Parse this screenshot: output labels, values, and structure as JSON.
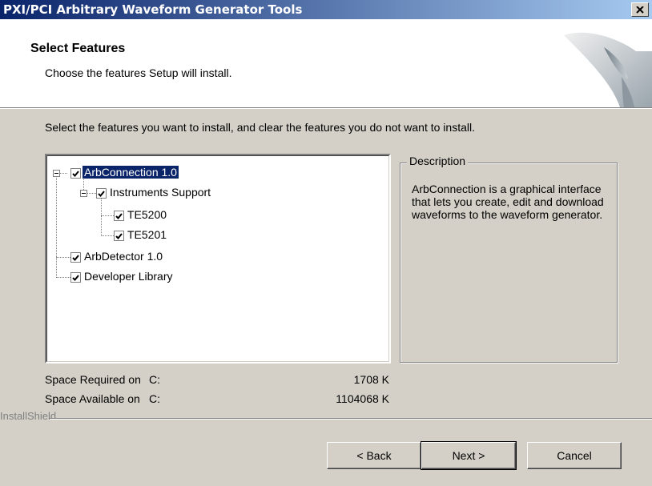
{
  "window": {
    "title": "PXI/PCI Arbitrary Waveform Generator Tools"
  },
  "header": {
    "title": "Select Features",
    "subtitle": "Choose the features Setup will install."
  },
  "instruction": "Select the features you want to install, and clear the features you do not want to install.",
  "tree": {
    "items": [
      {
        "label": "ArbConnection 1.0",
        "checked": true
      },
      {
        "label": "Instruments Support",
        "checked": true
      },
      {
        "label": "TE5200",
        "checked": true
      },
      {
        "label": "TE5201",
        "checked": true
      },
      {
        "label": "ArbDetector 1.0",
        "checked": true
      },
      {
        "label": "Developer Library",
        "checked": true
      }
    ]
  },
  "description": {
    "legend": "Description",
    "text": "ArbConnection is a graphical interface that lets you create, edit and download waveforms to the waveform generator."
  },
  "space": {
    "required": {
      "label": "Space Required on",
      "drive": "C:",
      "value": "1708 K"
    },
    "available": {
      "label": "Space Available on",
      "drive": "C:",
      "value": "1104068 K"
    }
  },
  "branding": "InstallShield",
  "buttons": {
    "back": "< Back",
    "next": "Next >",
    "cancel": "Cancel"
  }
}
